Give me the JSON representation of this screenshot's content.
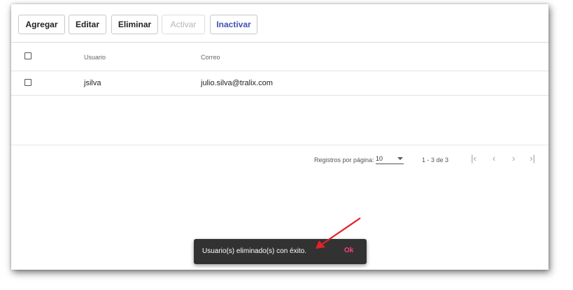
{
  "toolbar": {
    "add_label": "Agregar",
    "edit_label": "Editar",
    "delete_label": "Eliminar",
    "activate_label": "Activar",
    "deactivate_label": "Inactivar"
  },
  "table": {
    "columns": [
      "Usuario",
      "Correo"
    ],
    "rows": [
      {
        "usuario": "jsilva",
        "correo": "julio.silva@tralix.com"
      }
    ]
  },
  "pagination": {
    "rows_per_page_label": "Registros por página:",
    "rows_per_page_value": "10",
    "range_label": "1 - 3 de 3"
  },
  "snackbar": {
    "message": "Usuario(s) eliminado(s) con éxito.",
    "action": "Ok"
  },
  "colors": {
    "accent": "#3f51b5",
    "snackbar_bg": "#323232",
    "snackbar_action": "#ff4081",
    "annotation_arrow": "#e0222b"
  },
  "icons": [
    "first-page-icon",
    "chevron-left-icon",
    "chevron-right-icon",
    "last-page-icon",
    "dropdown-caret-icon"
  ]
}
